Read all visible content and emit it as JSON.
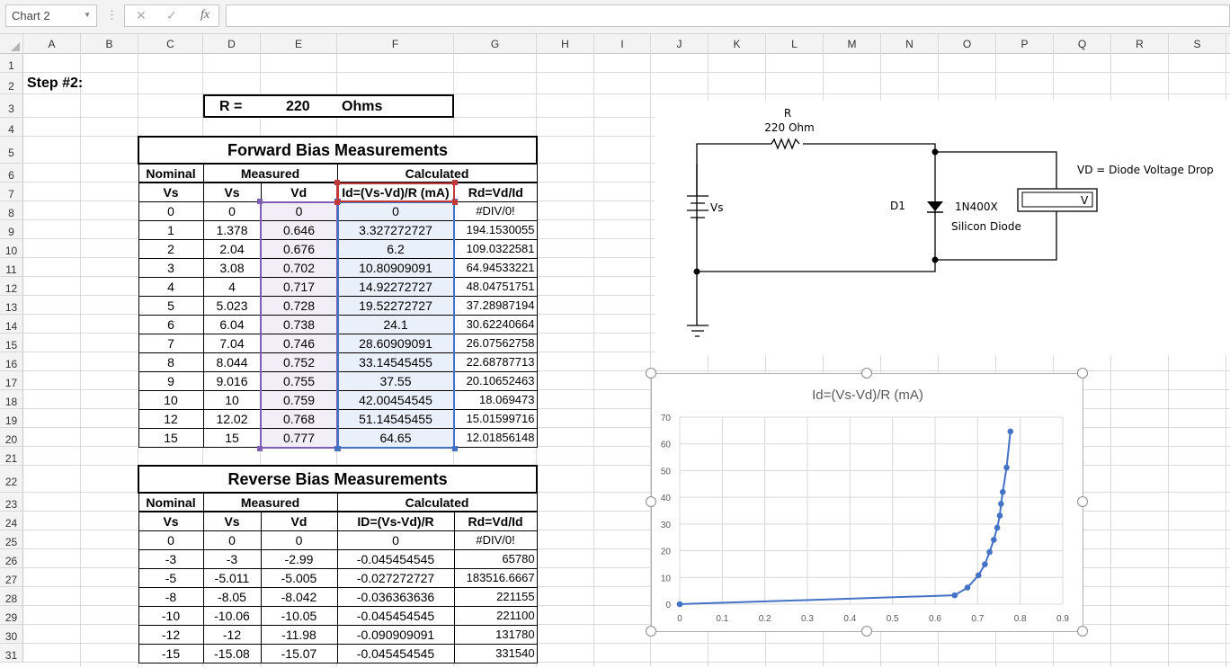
{
  "formula_bar": {
    "name_box": "Chart 2",
    "cancel_icon": "✕",
    "enter_icon": "✓",
    "fx_label": "fx",
    "formula": ""
  },
  "columns": [
    "A",
    "B",
    "C",
    "D",
    "E",
    "F",
    "G",
    "H",
    "I",
    "J",
    "K",
    "L",
    "M",
    "N",
    "O",
    "P",
    "Q",
    "R",
    "S"
  ],
  "row_numbers": [
    "1",
    "2",
    "3",
    "4",
    "5",
    "6",
    "7",
    "8",
    "9",
    "10",
    "11",
    "12",
    "13",
    "14",
    "15",
    "16",
    "17",
    "18",
    "19",
    "20",
    "21",
    "22",
    "23",
    "24",
    "25",
    "26",
    "27",
    "28",
    "29",
    "30",
    "31"
  ],
  "step_label": "Step #2:",
  "resistor": {
    "label": "R  =",
    "value": "220",
    "unit": "Ohms"
  },
  "forward": {
    "title": "Forward Bias Measurements",
    "groups": [
      "Nominal",
      "Measured",
      "Calculated"
    ],
    "headers": [
      "Vs",
      "Vs",
      "Vd",
      "Id=(Vs-Vd)/R (mA)",
      "Rd=Vd/Id"
    ],
    "rows": [
      [
        "0",
        "0",
        "0",
        "0",
        "#DIV/0!"
      ],
      [
        "1",
        "1.378",
        "0.646",
        "3.327272727",
        "194.1530055"
      ],
      [
        "2",
        "2.04",
        "0.676",
        "6.2",
        "109.0322581"
      ],
      [
        "3",
        "3.08",
        "0.702",
        "10.80909091",
        "64.94533221"
      ],
      [
        "4",
        "4",
        "0.717",
        "14.92272727",
        "48.04751751"
      ],
      [
        "5",
        "5.023",
        "0.728",
        "19.52272727",
        "37.28987194"
      ],
      [
        "6",
        "6.04",
        "0.738",
        "24.1",
        "30.62240664"
      ],
      [
        "7",
        "7.04",
        "0.746",
        "28.60909091",
        "26.07562758"
      ],
      [
        "8",
        "8.044",
        "0.752",
        "33.14545455",
        "22.68787713"
      ],
      [
        "9",
        "9.016",
        "0.755",
        "37.55",
        "20.10652463"
      ],
      [
        "10",
        "10",
        "0.759",
        "42.00454545",
        "18.069473"
      ],
      [
        "12",
        "12.02",
        "0.768",
        "51.14545455",
        "15.01599716"
      ],
      [
        "15",
        "15",
        "0.777",
        "64.65",
        "12.01856148"
      ]
    ]
  },
  "reverse": {
    "title": "Reverse Bias Measurements",
    "groups": [
      "Nominal",
      "Measured",
      "Calculated"
    ],
    "headers": [
      "Vs",
      "Vs",
      "Vd",
      "ID=(Vs-Vd)/R",
      "Rd=Vd/Id"
    ],
    "rows": [
      [
        "0",
        "0",
        "0",
        "0",
        "#DIV/0!"
      ],
      [
        "-3",
        "-3",
        "-2.99",
        "-0.045454545",
        "65780"
      ],
      [
        "-5",
        "-5.011",
        "-5.005",
        "-0.027272727",
        "183516.6667"
      ],
      [
        "-8",
        "-8.05",
        "-8.042",
        "-0.036363636",
        "221155"
      ],
      [
        "-10",
        "-10.06",
        "-10.05",
        "-0.045454545",
        "221100"
      ],
      [
        "-12",
        "-12",
        "-11.98",
        "-0.090909091",
        "131780"
      ],
      [
        "-15",
        "-15.08",
        "-15.07",
        "-0.045454545",
        "331540"
      ]
    ]
  },
  "circuit": {
    "r_label": "R",
    "r_value": "220  Ohm",
    "source": "Vs",
    "diode_ref": "D1",
    "diode_part": "1N400X",
    "diode_desc": "Silicon Diode",
    "meter": "V",
    "meter_note": "VD = Diode Voltage Drop"
  },
  "colors": {
    "series": "#4472c4",
    "vd_range": "#7f5fb4",
    "id_range": "#4472c4",
    "header_range": "#c0393b"
  },
  "chart_data": {
    "type": "scatter",
    "title": "Id=(Vs-Vd)/R (mA)",
    "xlim": [
      0,
      0.9
    ],
    "ylim": [
      0,
      70
    ],
    "xticks": [
      "0",
      "0.1",
      "0.2",
      "0.3",
      "0.4",
      "0.5",
      "0.6",
      "0.7",
      "0.8",
      "0.9"
    ],
    "yticks": [
      "0",
      "10",
      "20",
      "30",
      "40",
      "50",
      "60",
      "70"
    ],
    "grid": true,
    "smooth_lines_with_markers": true,
    "x": [
      0,
      0.646,
      0.676,
      0.702,
      0.717,
      0.728,
      0.738,
      0.746,
      0.752,
      0.755,
      0.759,
      0.768,
      0.777
    ],
    "y": [
      0,
      3.327272727,
      6.2,
      10.80909091,
      14.92272727,
      19.52272727,
      24.1,
      28.60909091,
      33.14545455,
      37.55,
      42.00454545,
      51.14545455,
      64.65
    ]
  }
}
